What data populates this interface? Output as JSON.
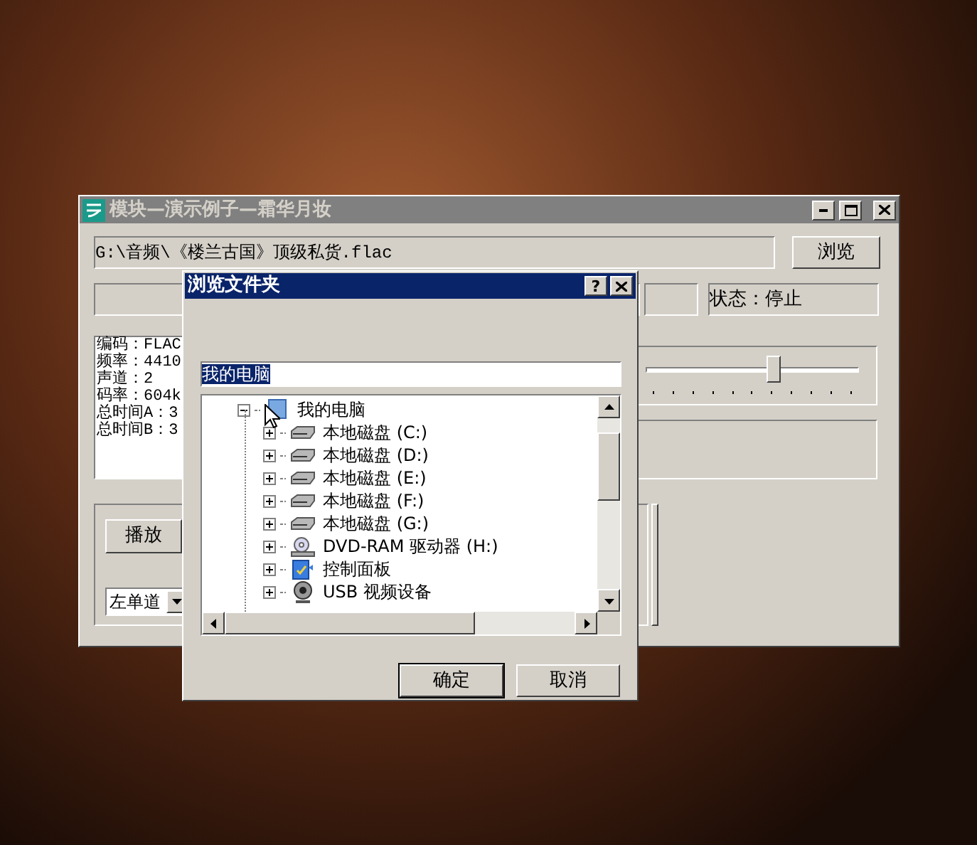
{
  "main_window": {
    "title": "模块—演示例子—霜华月妆",
    "active": false,
    "file_path": "G:\\音频\\《楼兰古国》顶级私货.flac",
    "browse_button": "浏览",
    "status": "状态：停止",
    "info_lines": [
      "编码：FLAC",
      "频率：4410",
      "声道：2",
      "码率：604k",
      "总时间A：3",
      "总时间B：3"
    ],
    "slider": {
      "level": 0.6
    },
    "play_button": "播放",
    "channel_select": {
      "value": "左单道"
    }
  },
  "dialog": {
    "title": "浏览文件夹",
    "active": true,
    "help_button": "?",
    "folder_field": {
      "value": "我的电脑"
    },
    "tree": [
      {
        "label": "我的电脑",
        "kind": "computer",
        "expanded": true,
        "children": [
          {
            "label": "本地磁盘 (C:)",
            "kind": "drive",
            "expanded": false
          },
          {
            "label": "本地磁盘 (D:)",
            "kind": "drive",
            "expanded": false
          },
          {
            "label": "本地磁盘 (E:)",
            "kind": "drive",
            "expanded": false
          },
          {
            "label": "本地磁盘 (F:)",
            "kind": "drive",
            "expanded": false
          },
          {
            "label": "本地磁盘 (G:)",
            "kind": "drive",
            "expanded": false
          },
          {
            "label": "DVD-RAM 驱动器 (H:)",
            "kind": "cd",
            "expanded": false
          },
          {
            "label": "控制面板",
            "kind": "control",
            "expanded": false
          },
          {
            "label": "USB 视频设备",
            "kind": "camera",
            "expanded": false
          }
        ]
      }
    ],
    "buttons": [
      "确定",
      "取消"
    ]
  }
}
